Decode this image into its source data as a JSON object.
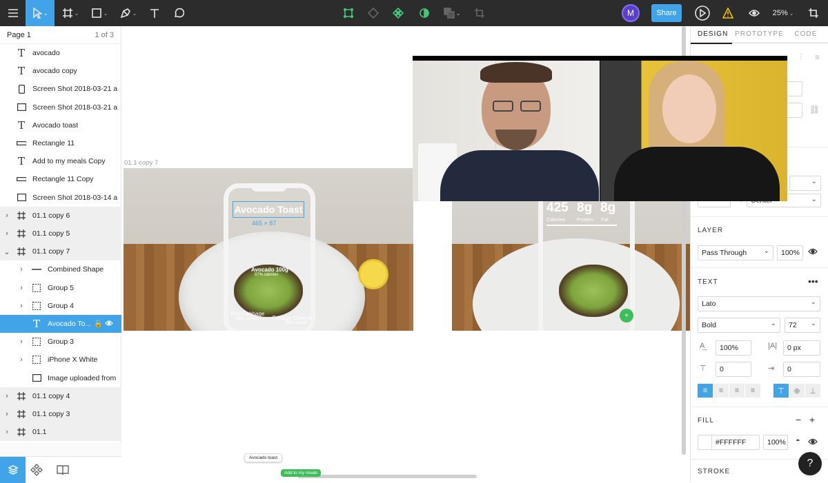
{
  "toolbar": {
    "user_initial": "M",
    "share_label": "Share",
    "zoom_label": "25%"
  },
  "pages": {
    "current": "Page 1",
    "count": "1 of 3"
  },
  "layers": [
    {
      "label": "avocado",
      "icon": "text-icon"
    },
    {
      "label": "avocado copy",
      "icon": "text-icon"
    },
    {
      "label": "Screen Shot 2018-03-21 at ...",
      "icon": "phone-image-icon"
    },
    {
      "label": "Screen Shot 2018-03-21 at ...",
      "icon": "image-rect-icon"
    },
    {
      "label": "Avocado toast",
      "icon": "text-icon"
    },
    {
      "label": "Rectangle 11",
      "icon": "rectangle-icon"
    },
    {
      "label": "Add to my meals Copy",
      "icon": "text-icon"
    },
    {
      "label": "Rectangle 11 Copy",
      "icon": "rectangle-icon"
    },
    {
      "label": "Screen Shot 2018-03-14 at ...",
      "icon": "image-rect-icon"
    },
    {
      "label": "01.1 copy 6",
      "icon": "frame-icon"
    },
    {
      "label": "01.1 copy 5",
      "icon": "frame-icon"
    },
    {
      "label": "01.1 copy 7",
      "icon": "frame-icon"
    },
    {
      "label": "Combined Shape",
      "icon": "line-icon"
    },
    {
      "label": "Group 5",
      "icon": "group-icon"
    },
    {
      "label": "Group 4",
      "icon": "group-icon"
    },
    {
      "label": "Avocado To...",
      "icon": "text-icon"
    },
    {
      "label": "Group 3",
      "icon": "group-icon"
    },
    {
      "label": "iPhone X White",
      "icon": "group-icon"
    },
    {
      "label": "Image uploaded from ...",
      "icon": "image-rect-icon"
    },
    {
      "label": "01.1 copy 4",
      "icon": "frame-icon"
    },
    {
      "label": "01.1 copy 3",
      "icon": "frame-icon"
    },
    {
      "label": "01.1",
      "icon": "frame-icon"
    }
  ],
  "canvas": {
    "frame_label": "01.1 copy 7",
    "app_title": "Avocado Toast",
    "size_badge": "465 × 87",
    "food_label_1": "Avocado 100g",
    "food_label_1_sub": "97% calories",
    "food_label_2": "Red Cabbage",
    "food_label_2_sub": "96% certain",
    "food_label_3": "Cottage Cheese",
    "food_label_3_sub": "96% certain",
    "stat_calories_value": "425",
    "stat_calories_label": "Calories",
    "stat_protein_value": "8g",
    "stat_protein_label": "Protein",
    "stat_fat_value": "8g",
    "stat_fat_label": "Fat",
    "add_btn": "+",
    "mini_tag_1": "Avocado toast",
    "mini_tag_2": "Add to my meals"
  },
  "inspector": {
    "tabs": [
      "DESIGN",
      "PROTOTYPE",
      "CODE"
    ],
    "vertical_align": "Center",
    "layer_title": "LAYER",
    "blend_mode": "Pass Through",
    "opacity": "100%",
    "text_title": "TEXT",
    "font_family": "Lato",
    "font_weight": "Bold",
    "font_size": "72",
    "line_height": "100%",
    "letter_spacing": "0 px",
    "paragraph_spacing": "0",
    "paragraph_indent": "0",
    "fill_title": "FILL",
    "fill_hex": "#FFFFFF",
    "fill_opacity": "100%",
    "stroke_title": "STROKE"
  },
  "help_label": "?",
  "colors": {
    "accent": "#42a4e8",
    "toolbar_bg": "#2c2c2c",
    "green": "#3fbd5a",
    "avatar": "#5b3fc4"
  }
}
